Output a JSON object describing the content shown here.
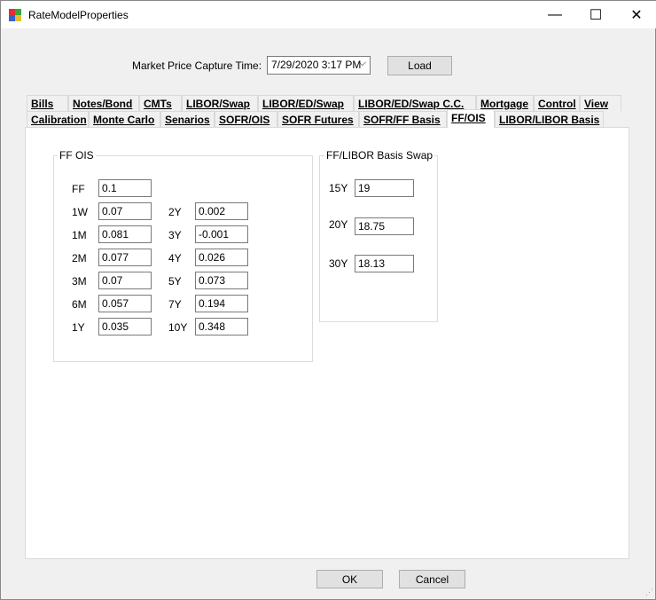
{
  "window": {
    "title": "RateModelProperties",
    "minimize": "—",
    "maximize": "☐",
    "close": "✕"
  },
  "header": {
    "capture_label": "Market Price Capture Time:",
    "capture_value": "7/29/2020 3:17 PM",
    "load_label": "Load"
  },
  "tabs_row1": [
    "Bills",
    "Notes/Bond",
    "CMTs",
    "LIBOR/Swap",
    "LIBOR/ED/Swap",
    "LIBOR/ED/Swap C.C.",
    "Mortgage",
    "Control",
    "View"
  ],
  "tabs_row2": [
    "Calibration",
    "Monte Carlo",
    "Senarios",
    "SOFR/OIS",
    "SOFR Futures",
    "SOFR/FF Basis",
    "FF/OIS",
    "LIBOR/LIBOR Basis"
  ],
  "selected_tab": "FF/OIS",
  "ff_ois": {
    "title": "FF OIS",
    "ff": {
      "label": "FF",
      "value": "0.1"
    },
    "left": [
      {
        "label": "1W",
        "value": "0.07"
      },
      {
        "label": "1M",
        "value": "0.081"
      },
      {
        "label": "2M",
        "value": "0.077"
      },
      {
        "label": "3M",
        "value": "0.07"
      },
      {
        "label": "6M",
        "value": "0.057"
      },
      {
        "label": "1Y",
        "value": "0.035"
      }
    ],
    "right": [
      {
        "label": "2Y",
        "value": "0.002"
      },
      {
        "label": "3Y",
        "value": "-0.001"
      },
      {
        "label": "4Y",
        "value": "0.026"
      },
      {
        "label": "5Y",
        "value": "0.073"
      },
      {
        "label": "7Y",
        "value": "0.194"
      },
      {
        "label": "10Y",
        "value": "0.348"
      }
    ]
  },
  "basis_swap": {
    "title": "FF/LIBOR Basis Swap",
    "items": [
      {
        "label": "15Y",
        "value": "19"
      },
      {
        "label": "20Y",
        "value": "18.75"
      },
      {
        "label": "30Y",
        "value": "18.13"
      }
    ]
  },
  "footer": {
    "ok": "OK",
    "cancel": "Cancel"
  }
}
